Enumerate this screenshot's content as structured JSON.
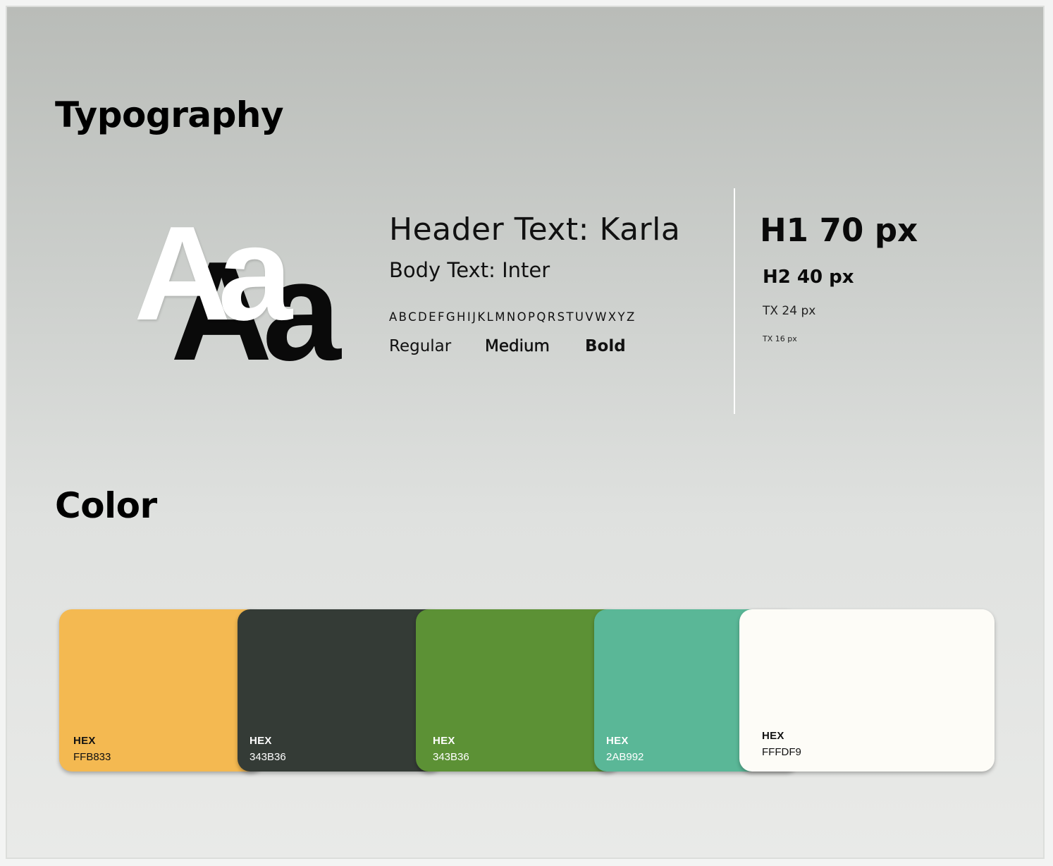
{
  "typography": {
    "title": "Typography",
    "specimen_back": "Aa",
    "specimen_front": "Aa",
    "header_text": "Header Text: Karla",
    "body_text": "Body Text: Inter",
    "alphabet": "ABCDEFGHIJKLMNOPQRSTUVWXYZ",
    "weights": [
      "Regular",
      "Medium",
      "Bold"
    ],
    "sizes": {
      "h1": "H1 70 px",
      "h2": "H2 40 px",
      "tx24": "TX 24 px",
      "tx16": "TX 16 px"
    }
  },
  "color": {
    "title": "Color",
    "swatches": [
      {
        "key": "HEX",
        "value": "FFB833",
        "fill": "#f4b951",
        "text_color": "#111111"
      },
      {
        "key": "HEX",
        "value": "343B36",
        "fill": "#343b36",
        "text_color": "#ffffff"
      },
      {
        "key": "HEX",
        "value": "343B36",
        "fill": "#5c9135",
        "text_color": "#ffffff"
      },
      {
        "key": "HEX",
        "value": "2AB992",
        "fill": "#5ab797",
        "text_color": "#ffffff"
      },
      {
        "key": "HEX",
        "value": "FFFDF9",
        "fill": "#fdfcf7",
        "text_color": "#111111"
      }
    ]
  }
}
